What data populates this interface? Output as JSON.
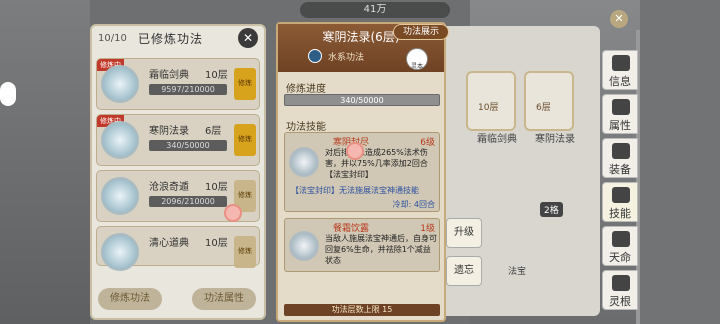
{
  "top": {
    "currency": "41万"
  },
  "left_panel": {
    "count": "10/10",
    "title": "已修炼功法",
    "items": [
      {
        "tag": "修炼中",
        "name": "霜临剑典",
        "level": "10层",
        "progress": "9597/210000",
        "button": "修炼"
      },
      {
        "tag": "修炼中",
        "name": "寒阴法录",
        "level": "6层",
        "progress": "340/50000",
        "button": "修炼"
      },
      {
        "tag": "",
        "name": "沧浪奇遁",
        "level": "10层",
        "progress": "2096/210000",
        "button": "修炼"
      },
      {
        "tag": "",
        "name": "清心道典",
        "level": "10层",
        "progress": "",
        "button": "修炼"
      }
    ],
    "bottom_buttons": [
      "修炼功法",
      "功法属性"
    ]
  },
  "popup": {
    "demo_button": "功法展示",
    "title": "寒阴法录(6层)",
    "subtitle": "水系功法",
    "badge": "灵本",
    "progress_label": "修炼进度",
    "progress": "340/50000",
    "skills_label": "功法技能",
    "skills": [
      {
        "name": "寒阴封尽",
        "level": "6级",
        "desc": "对后排敌人造成265%法术伤害，并以75%几率添加2回合【法宝封印】",
        "extra": "【法宝封印】无法施展法宝神通技能",
        "cooldown": "冷却: 4回合"
      },
      {
        "name": "餐霜饮露",
        "level": "1级",
        "desc": "当敌人施展法宝神通后，自身可回复6%生命，并祛除1个减益状态"
      }
    ],
    "limit": "功法层数上限 15"
  },
  "actions": {
    "upgrade": "升级",
    "forget": "遗忘"
  },
  "book": {
    "cards": [
      {
        "name": "霜临剑典",
        "level": "10层"
      },
      {
        "name": "寒阴法录",
        "level": "6层"
      }
    ],
    "count_badge": "2格"
  },
  "side_tabs": [
    "信息",
    "属性",
    "装备",
    "技能",
    "天命",
    "灵根"
  ],
  "labels": {
    "fabao": "法宝"
  }
}
